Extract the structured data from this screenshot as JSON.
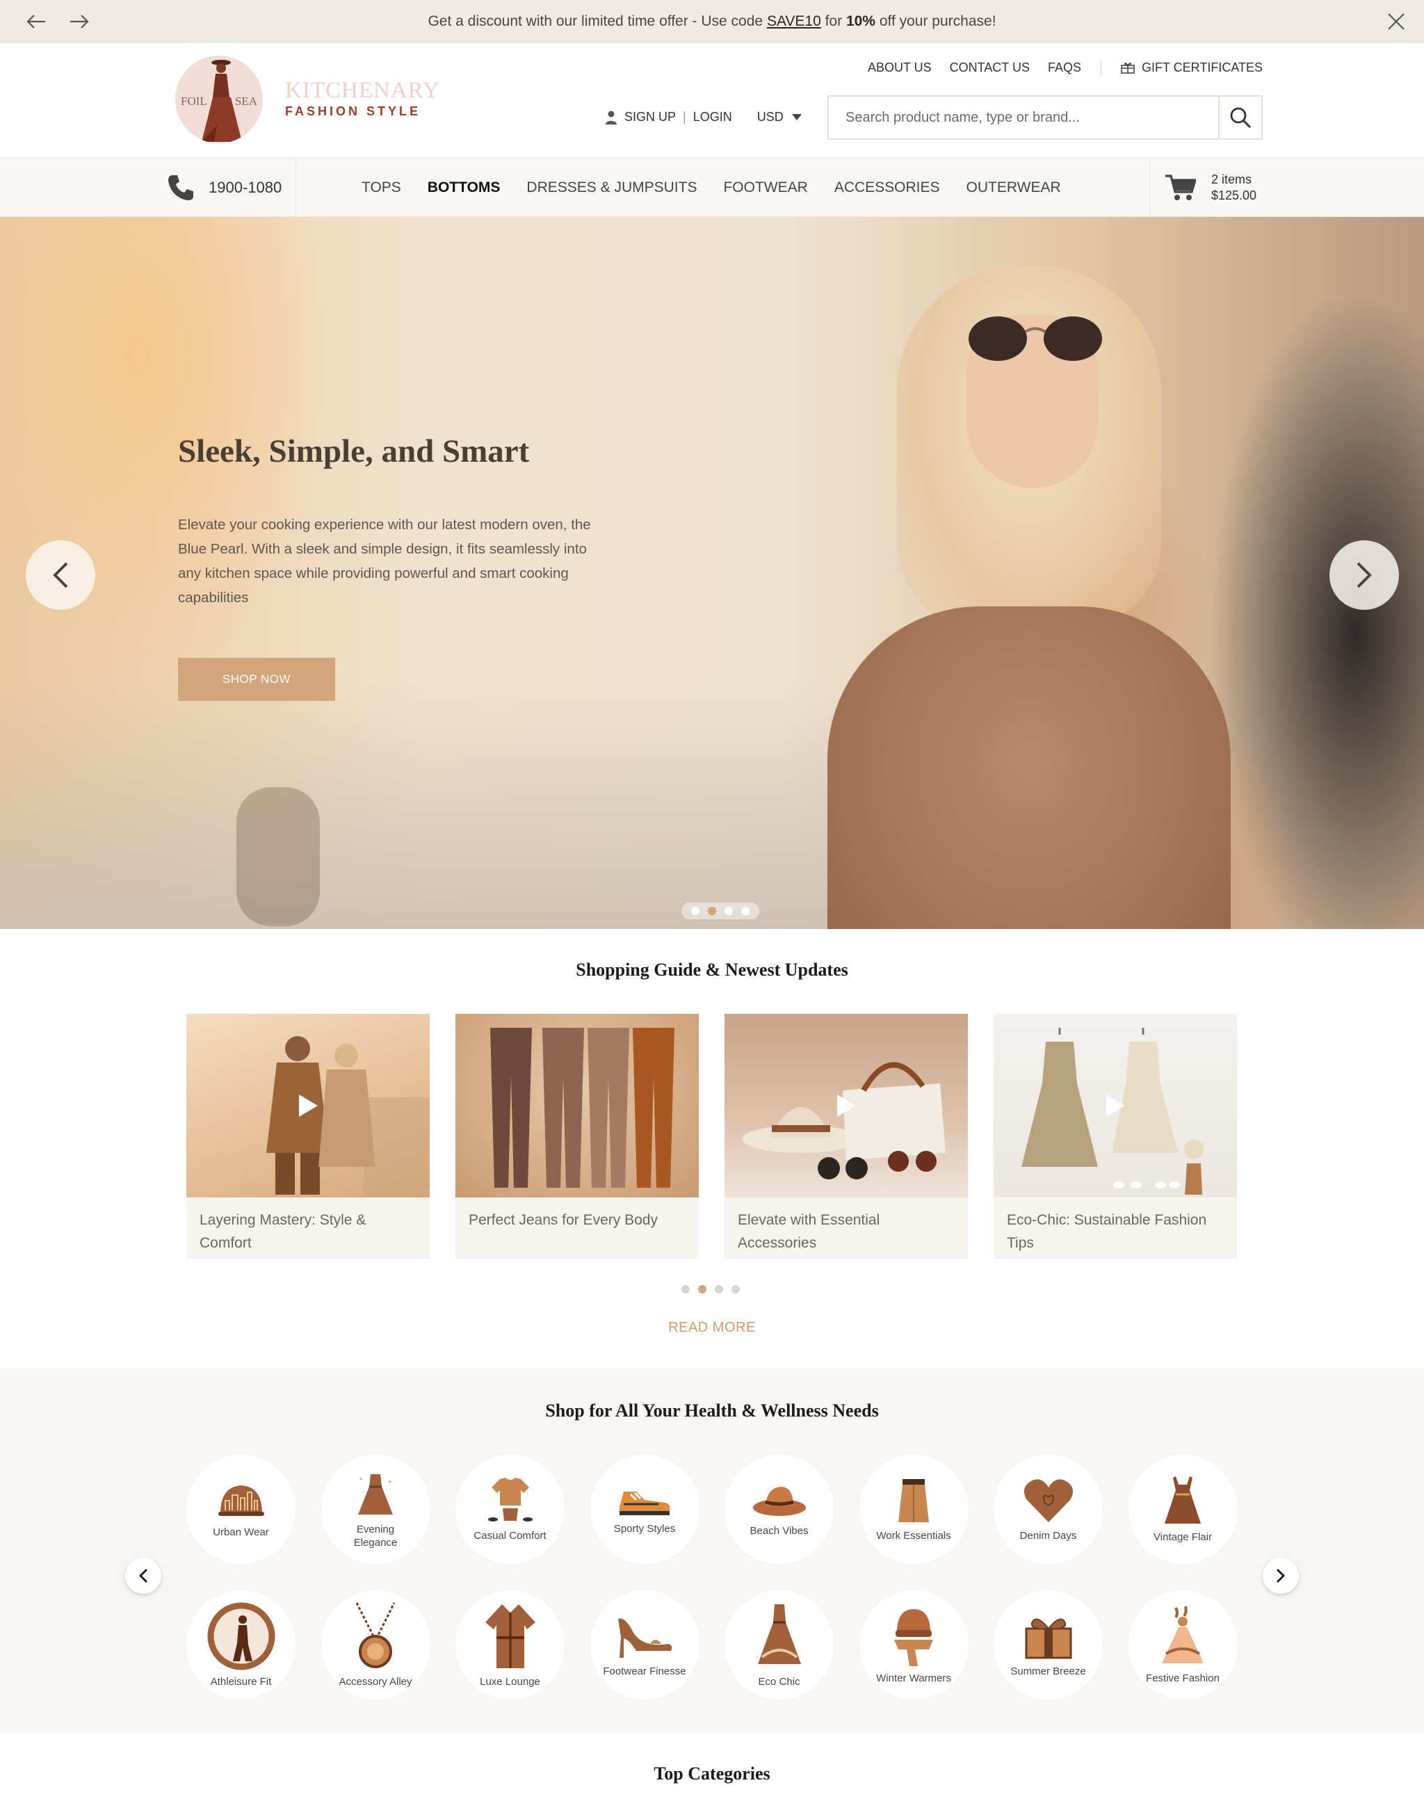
{
  "promo": {
    "text_before": "Get a discount with our limited time offer - Use code ",
    "code": "SAVE10",
    "text_for": " for ",
    "percent": "10%",
    "text_after": " off your purchase!"
  },
  "brand": {
    "logo_left": "FOIL",
    "logo_right": "SEA",
    "name": "KITCHENARY",
    "tagline": "FASHION STYLE"
  },
  "top_links": {
    "about": "ABOUT US",
    "contact": "CONTACT US",
    "faqs": "FAQS",
    "gift": "GIFT CERTIFICATES"
  },
  "account": {
    "sign_up": "SIGN UP",
    "separator": "|",
    "login": "LOGIN",
    "currency": "USD"
  },
  "search": {
    "placeholder": "Search product name, type or brand..."
  },
  "nav": {
    "phone": "1900-1080",
    "items": [
      "TOPS",
      "BOTTOMS",
      "DRESSES & JUMPSUITS",
      "FOOTWEAR",
      "ACCESSORIES",
      "OUTERWEAR"
    ],
    "active": "BOTTOMS"
  },
  "cart": {
    "items": "2 items",
    "total": "$125.00"
  },
  "hero": {
    "title": "Sleek, Simple, and Smart",
    "description": "Elevate your cooking experience with our latest modern oven, the Blue Pearl. With a sleek and simple design, it fits seamlessly into any kitchen space while providing powerful and smart cooking capabilities",
    "cta": "SHOP NOW",
    "slide_count": 4,
    "active_slide": 2
  },
  "guide": {
    "title": "Shopping Guide & Newest Updates",
    "cards": [
      {
        "title": "Layering Mastery: Style & Comfort"
      },
      {
        "title": "Perfect Jeans for Every Body"
      },
      {
        "title": "Elevate with Essential Accessories"
      },
      {
        "title": "Eco-Chic: Sustainable Fashion Tips"
      }
    ],
    "page_count": 4,
    "active_page": 2,
    "read_more": "READ MORE"
  },
  "wellness": {
    "title": "Shop for All Your Health & Wellness Needs",
    "categories": [
      {
        "label": "Urban Wear",
        "icon": "hat-city-icon"
      },
      {
        "label": "Evening Elegance",
        "icon": "evening-dress-icon"
      },
      {
        "label": "Casual Comfort",
        "icon": "tshirt-outfit-icon"
      },
      {
        "label": "Sporty Styles",
        "icon": "sneaker-icon"
      },
      {
        "label": "Beach Vibes",
        "icon": "sun-hat-icon"
      },
      {
        "label": "Work Essentials",
        "icon": "skirt-icon"
      },
      {
        "label": "Denim Days",
        "icon": "heart-icon"
      },
      {
        "label": "Vintage Flair",
        "icon": "vintage-dress-icon"
      },
      {
        "label": "Athleisure Fit",
        "icon": "athlete-circle-icon"
      },
      {
        "label": "Accessory Alley",
        "icon": "pendant-necklace-icon"
      },
      {
        "label": "Luxe Lounge",
        "icon": "robe-icon"
      },
      {
        "label": "Footwear Finesse",
        "icon": "high-heel-icon"
      },
      {
        "label": "Eco Chic",
        "icon": "eco-dress-icon"
      },
      {
        "label": "Winter Warmers",
        "icon": "beanie-scarf-icon"
      },
      {
        "label": "Summer Breeze",
        "icon": "gift-box-icon"
      },
      {
        "label": "Festive Fashion",
        "icon": "festive-figure-icon"
      }
    ]
  },
  "top_categories": {
    "title": "Top Categories"
  },
  "colors": {
    "accent": "#d4a57b",
    "read_more": "#d19a66",
    "promo_bg": "#efeae3",
    "brand_red": "#9e3b2a",
    "icon_brown": "#a0613a"
  }
}
